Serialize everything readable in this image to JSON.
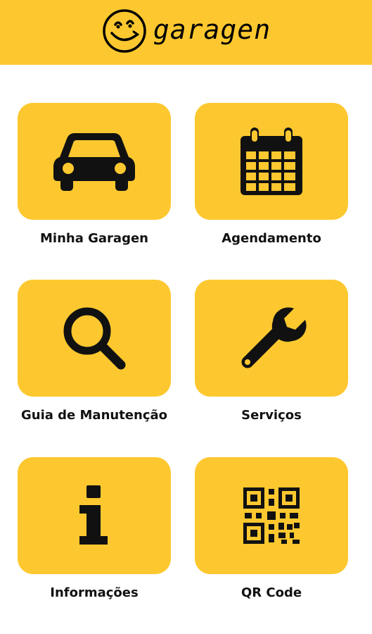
{
  "app": {
    "name": "garagen",
    "header_color": "#fdc82f",
    "logo_icon": "smiley-face-icon"
  },
  "menu": {
    "items": [
      {
        "label": "Minha Garagen",
        "icon": "car-icon"
      },
      {
        "label": "Agendamento",
        "icon": "calendar-icon"
      },
      {
        "label": "Guia de Manutenção",
        "icon": "search-icon"
      },
      {
        "label": "Serviços",
        "icon": "wrench-icon"
      },
      {
        "label": "Informações",
        "icon": "info-icon"
      },
      {
        "label": "QR Code",
        "icon": "qr-code-icon"
      }
    ]
  },
  "theme": {
    "tile_color": "#fdc82f",
    "icon_color": "#111111"
  }
}
